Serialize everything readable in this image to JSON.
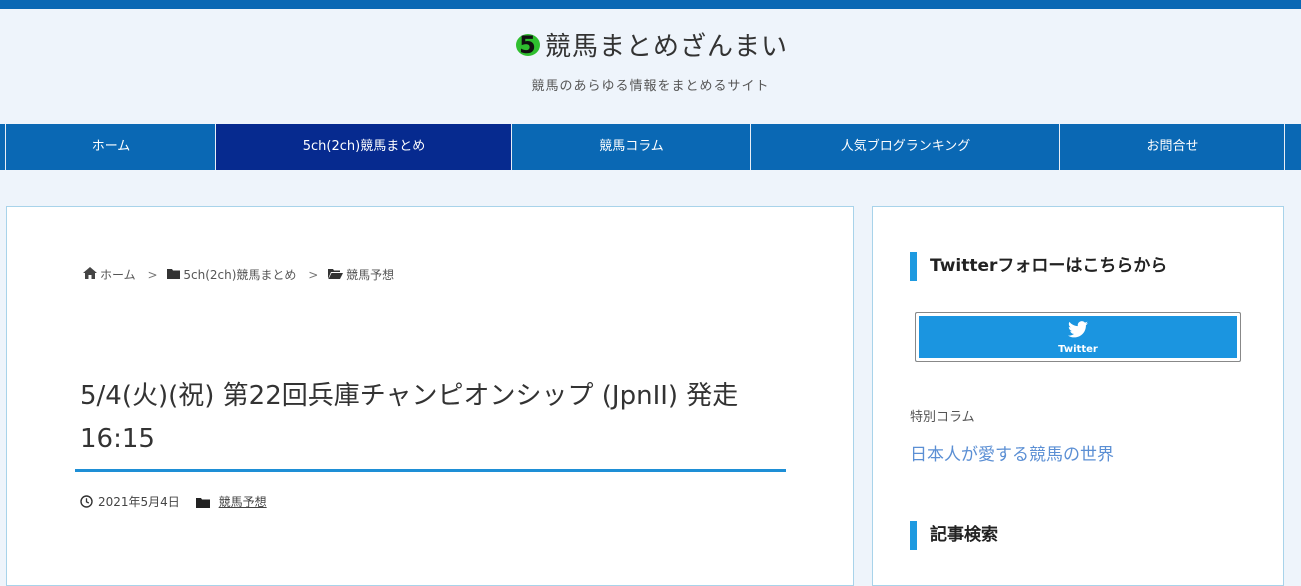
{
  "site": {
    "title": "競馬まとめざんまい",
    "tagline": "競馬のあらゆる情報をまとめるサイト",
    "logo_text": "5"
  },
  "nav": {
    "items": [
      {
        "label": "ホーム",
        "active": false
      },
      {
        "label": "5ch(2ch)競馬まとめ",
        "active": true
      },
      {
        "label": "競馬コラム",
        "active": false
      },
      {
        "label": "人気ブログランキング",
        "active": false
      },
      {
        "label": "お問合せ",
        "active": false
      }
    ]
  },
  "breadcrumb": {
    "home": "ホーム",
    "sep": ">",
    "level1": "5ch(2ch)競馬まとめ",
    "level2": "競馬予想"
  },
  "post": {
    "title": "5/4(火)(祝) 第22回兵庫チャンピオンシップ (JpnII) 発走16:15",
    "date": "2021年5月4日",
    "category": "競馬予想"
  },
  "sidebar": {
    "twitter_widget_title": "Twitterフォローはこちらから",
    "twitter_button_label": "Twitter",
    "special_column_label": "特別コラム",
    "special_column_link": "日本人が愛する競馬の世界",
    "search_widget_title": "記事検索"
  },
  "colors": {
    "brand_blue": "#0a68b4",
    "active_nav": "#062a8f",
    "accent": "#1e9ae0",
    "twitter": "#1b95e0",
    "link": "#5b8fd4"
  }
}
